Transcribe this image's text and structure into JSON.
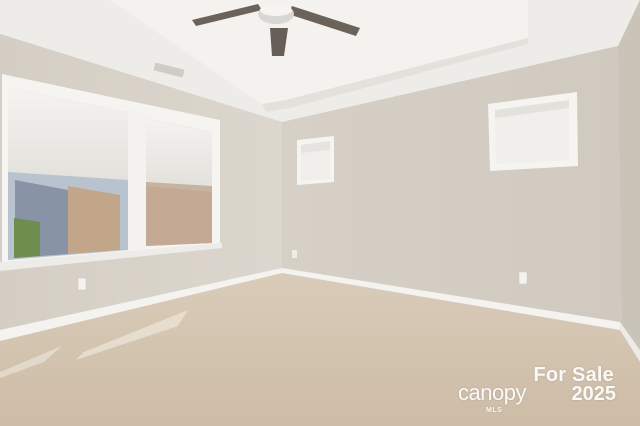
{
  "watermark": {
    "line1": "For Sale",
    "brand": "canopy",
    "sub": "MLS",
    "year": "2025"
  },
  "colors": {
    "wall": "#d8d3ca",
    "ceiling": "#efede9",
    "carpet": "#d6c7b3",
    "trim": "#f5f4f1"
  }
}
